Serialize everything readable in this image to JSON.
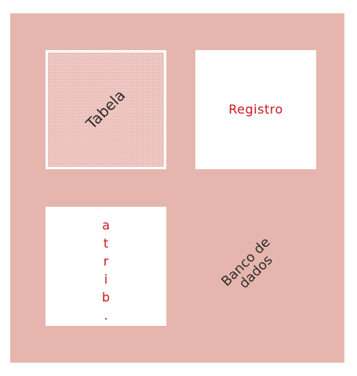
{
  "board": {
    "background_color": "#e6b6ae",
    "cards": {
      "tabela": {
        "label": "Tabela"
      },
      "registro": {
        "label": "Registro",
        "text_color": "#d0141a"
      },
      "atrib": {
        "label": "a\nt\nr\ni\nb\n.",
        "text_color": "#d0141a"
      }
    },
    "banco": {
      "label": "Banco de\ndados"
    }
  }
}
